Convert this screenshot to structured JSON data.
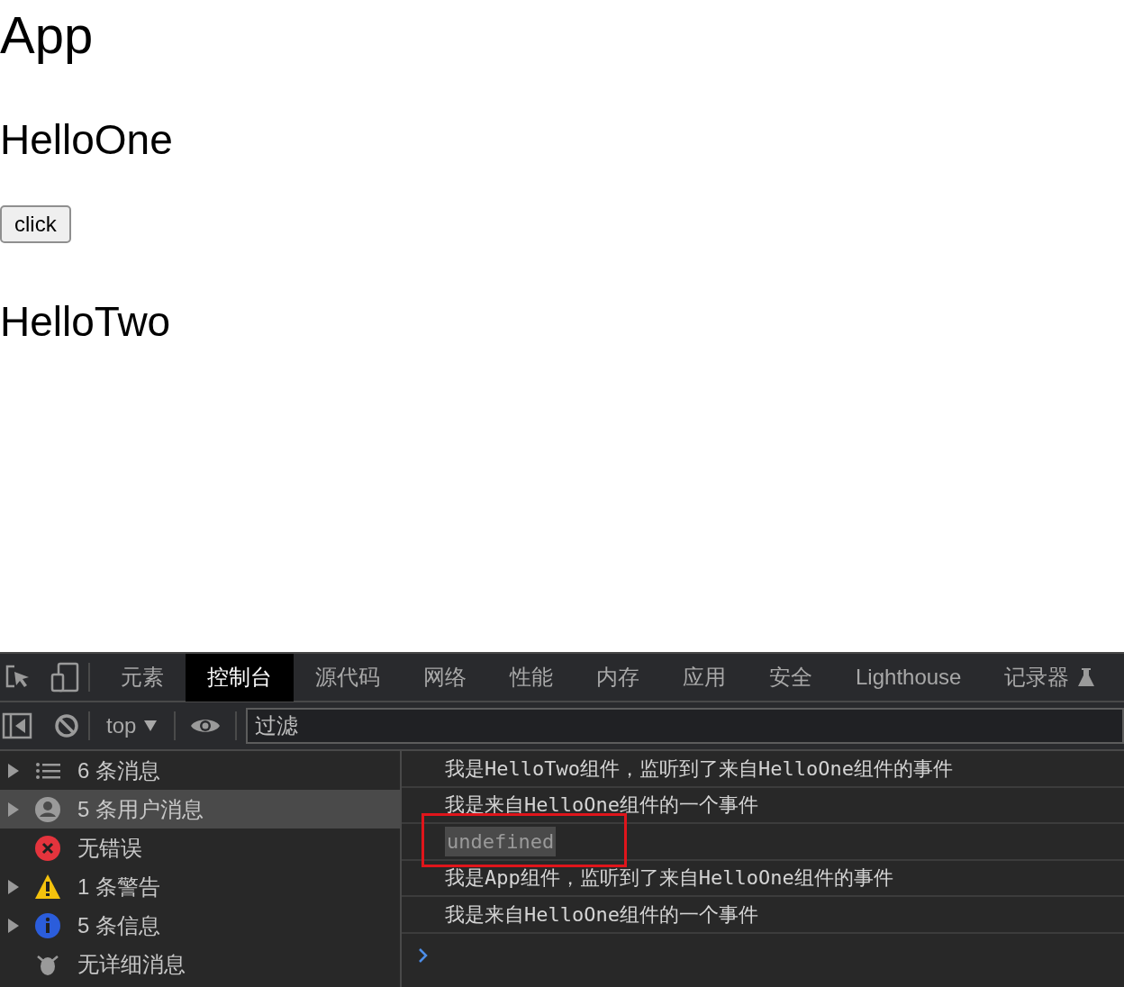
{
  "page": {
    "title": "App",
    "sections": [
      {
        "kind": "heading",
        "text": "HelloOne"
      },
      {
        "kind": "button",
        "text": "click"
      },
      {
        "kind": "heading",
        "text": "HelloTwo"
      }
    ]
  },
  "devtools": {
    "tabs": [
      {
        "label": "元素",
        "selected": false
      },
      {
        "label": "控制台",
        "selected": true
      },
      {
        "label": "源代码",
        "selected": false
      },
      {
        "label": "网络",
        "selected": false
      },
      {
        "label": "性能",
        "selected": false
      },
      {
        "label": "内存",
        "selected": false
      },
      {
        "label": "应用",
        "selected": false
      },
      {
        "label": "安全",
        "selected": false
      },
      {
        "label": "Lighthouse",
        "selected": false
      },
      {
        "label": "记录器",
        "selected": false
      }
    ],
    "context": "top",
    "filter": {
      "placeholder": "过滤"
    },
    "sidebar": [
      {
        "kind": "all",
        "label": "6 条消息",
        "expandable": true,
        "selected": false
      },
      {
        "kind": "user",
        "label": "5 条用户消息",
        "expandable": true,
        "selected": true
      },
      {
        "kind": "error",
        "label": "无错误",
        "expandable": false,
        "selected": false
      },
      {
        "kind": "warning",
        "label": "1 条警告",
        "expandable": true,
        "selected": false
      },
      {
        "kind": "info",
        "label": "5 条信息",
        "expandable": true,
        "selected": false
      },
      {
        "kind": "verbose",
        "label": "无详细消息",
        "expandable": false,
        "selected": false
      }
    ],
    "messages": [
      {
        "kind": "log",
        "text": "我是HelloTwo组件，监听到了来自HelloOne组件的事件",
        "highlighted": false
      },
      {
        "kind": "log",
        "text": "我是来自HelloOne组件的一个事件",
        "highlighted": false
      },
      {
        "kind": "result",
        "text": "undefined",
        "highlighted": true
      },
      {
        "kind": "log",
        "text": "我是App组件，监听到了来自HelloOne组件的事件",
        "highlighted": false
      },
      {
        "kind": "log",
        "text": "我是来自HelloOne组件的一个事件",
        "highlighted": false
      }
    ]
  }
}
